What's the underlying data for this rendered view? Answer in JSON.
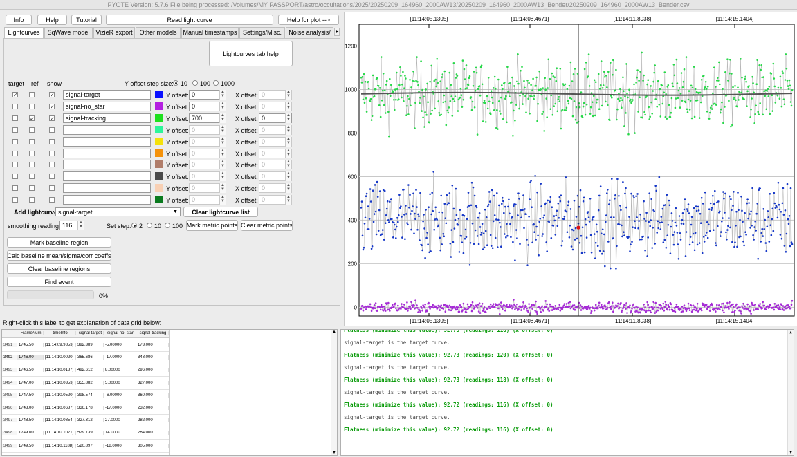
{
  "window": {
    "title": "PYOTE Version: 5.7.6  File being processed: /Volumes/MY PASSPORT/astro/occultations/2025/20250209_164960_2000AW13/20250209_164960_2000AW13_Bender/20250209_164960_2000AW13_Bender.csv"
  },
  "toolbar": {
    "info": "Info",
    "help": "Help",
    "tutorial": "Tutorial",
    "read_lc": "Read light curve",
    "help_plot": "Help for plot -->"
  },
  "tabs": [
    "Lightcurves",
    "SqWave model",
    "VizieR export",
    "Other models",
    "Manual timestamps",
    "Settings/Misc.",
    "Noise analysis/"
  ],
  "lc_help": "Lightcurves tab help",
  "headers": {
    "target": "target",
    "ref": "ref",
    "show": "show",
    "step_label": "Y offset step size:",
    "step_opts": [
      "10",
      "100",
      "1000"
    ]
  },
  "lc_rows": [
    {
      "name": "signal-target",
      "color": "#0a10ff",
      "target": true,
      "ref": false,
      "show": true,
      "y": "0",
      "x": "0",
      "active": true,
      "x_active": false
    },
    {
      "name": "signal-no_star",
      "color": "#b41fe0",
      "target": false,
      "ref": false,
      "show": true,
      "y": "0",
      "x": "0",
      "active": true,
      "x_active": false
    },
    {
      "name": "signal-tracking",
      "color": "#1fe01f",
      "target": false,
      "ref": true,
      "show": true,
      "y": "700",
      "x": "0",
      "active": true,
      "x_active": true
    },
    {
      "name": "",
      "color": "#2ef59a",
      "target": false,
      "ref": false,
      "show": false,
      "y": "0",
      "x": "0",
      "active": false,
      "x_active": false
    },
    {
      "name": "",
      "color": "#f5e10a",
      "target": false,
      "ref": false,
      "show": false,
      "y": "0",
      "x": "0",
      "active": false,
      "x_active": false
    },
    {
      "name": "",
      "color": "#f5920a",
      "target": false,
      "ref": false,
      "show": false,
      "y": "0",
      "x": "0",
      "active": false,
      "x_active": false
    },
    {
      "name": "",
      "color": "#b07d6a",
      "target": false,
      "ref": false,
      "show": false,
      "y": "0",
      "x": "0",
      "active": false,
      "x_active": false
    },
    {
      "name": "",
      "color": "#4a4a4a",
      "target": false,
      "ref": false,
      "show": false,
      "y": "0",
      "x": "0",
      "active": false,
      "x_active": false
    },
    {
      "name": "",
      "color": "#f8d0b4",
      "target": false,
      "ref": false,
      "show": false,
      "y": "0",
      "x": "0",
      "active": false,
      "x_active": false
    },
    {
      "name": "",
      "color": "#0a7a1e",
      "target": false,
      "ref": false,
      "show": false,
      "y": "0",
      "x": "0",
      "active": false,
      "x_active": false
    }
  ],
  "labels": {
    "y_offset": "Y offset:",
    "x_offset": "X offset:",
    "add_lc": "Add lightcurve",
    "add_lc_value": "signal-target",
    "clear_lc": "Clear lightcurve list",
    "smoothing": "smoothing readings",
    "smoothing_value": "116",
    "set_step": "Set step:",
    "set_step_opts": [
      "2",
      "10",
      "100"
    ],
    "mark_metric": "Mark metric points",
    "clear_metric": "Clear metric points",
    "mark_baseline": "Mark baseline region",
    "calc_baseline": "Calc baseline mean/sigma/corr coeffs",
    "clear_baseline": "Clear baseline regions",
    "find_event": "Find event",
    "progress_text": "0%",
    "grid_caption": "Right-click this label to get explanation of data grid below:"
  },
  "progress": 0,
  "grid": {
    "columns": [
      "FrameNum",
      "timeInfo",
      "signal-target",
      "signal-no_star",
      "signal-tracking"
    ],
    "rows": [
      [
        "3491",
        "1745.50",
        "[11:14:09.9853]",
        "392.389",
        "-5.00000",
        "173.000"
      ],
      [
        "3492",
        "1746.00",
        "[11:14:10.0020]",
        "365.686",
        "-17.0000",
        "348.000"
      ],
      [
        "3493",
        "1746.50",
        "[11:14:10.0187]",
        "492.612",
        "8.00000",
        "296.000"
      ],
      [
        "3494",
        "1747.00",
        "[11:14:10.0353]",
        "355.882",
        "5.00000",
        "327.000"
      ],
      [
        "3495",
        "1747.50",
        "[11:14:10.0520]",
        "398.574",
        "-6.00000",
        "360.000"
      ],
      [
        "3496",
        "1748.00",
        "[11:14:10.0687]",
        "336.178",
        "-17.0000",
        "232.000"
      ],
      [
        "3497",
        "1748.50",
        "[11:14:10.0854]",
        "327.312",
        "27.0000",
        "282.000"
      ],
      [
        "3498",
        "1749.00",
        "[11:14:10.1021]",
        "529.739",
        "14.0000",
        "264.000"
      ],
      [
        "3499",
        "1749.50",
        "[11:14:10.1188]",
        "520.897",
        "-18.0000",
        "305.000"
      ]
    ]
  },
  "log": [
    {
      "text": "Flatness (minimize this value): 92.73 (readings: 118) (X offset: 0)",
      "bold": true
    },
    {
      "text": "signal-target is the target curve.",
      "bold": false
    },
    {
      "text": "Flatness (minimize this value): 92.73 (readings: 120) (X offset: 0)",
      "bold": true
    },
    {
      "text": "signal-target is the target curve.",
      "bold": false
    },
    {
      "text": "Flatness (minimize this value): 92.73 (readings: 118) (X offset: 0)",
      "bold": true
    },
    {
      "text": "signal-target is the target curve.",
      "bold": false
    },
    {
      "text": "Flatness (minimize this value): 92.72 (readings: 116) (X offset: 0)",
      "bold": true
    },
    {
      "text": "signal-target is the target curve.",
      "bold": false
    },
    {
      "text": "Flatness (minimize this value): 92.72 (readings: 116) (X offset: 0)",
      "bold": true
    }
  ],
  "colors": {
    "log_green": "#0a9b0a",
    "target_series": "#1638c8",
    "no_star_series": "#a52ad6",
    "tracking_series": "#28d84a",
    "smooth_line": "#555555",
    "marker": "#e01010"
  },
  "chart_data": {
    "type": "scatter",
    "x_tick_labels": [
      "[11:14:05.1305]",
      "[11:14:08.4671]",
      "[11:14:11.8038]",
      "[11:14:15.1404]"
    ],
    "y_ticks": [
      0,
      200,
      400,
      600,
      800,
      1000,
      1200
    ],
    "ylim": [
      -40,
      1300
    ],
    "grid": true,
    "event_marker_time": "[11:14:10.0020]",
    "series": [
      {
        "name": "signal-tracking",
        "mean": 980,
        "spread": 75
      },
      {
        "name": "signal-target",
        "mean": 400,
        "spread": 90
      },
      {
        "name": "signal-no_star",
        "mean": 0,
        "spread": 12
      }
    ],
    "marker_value": 366
  }
}
